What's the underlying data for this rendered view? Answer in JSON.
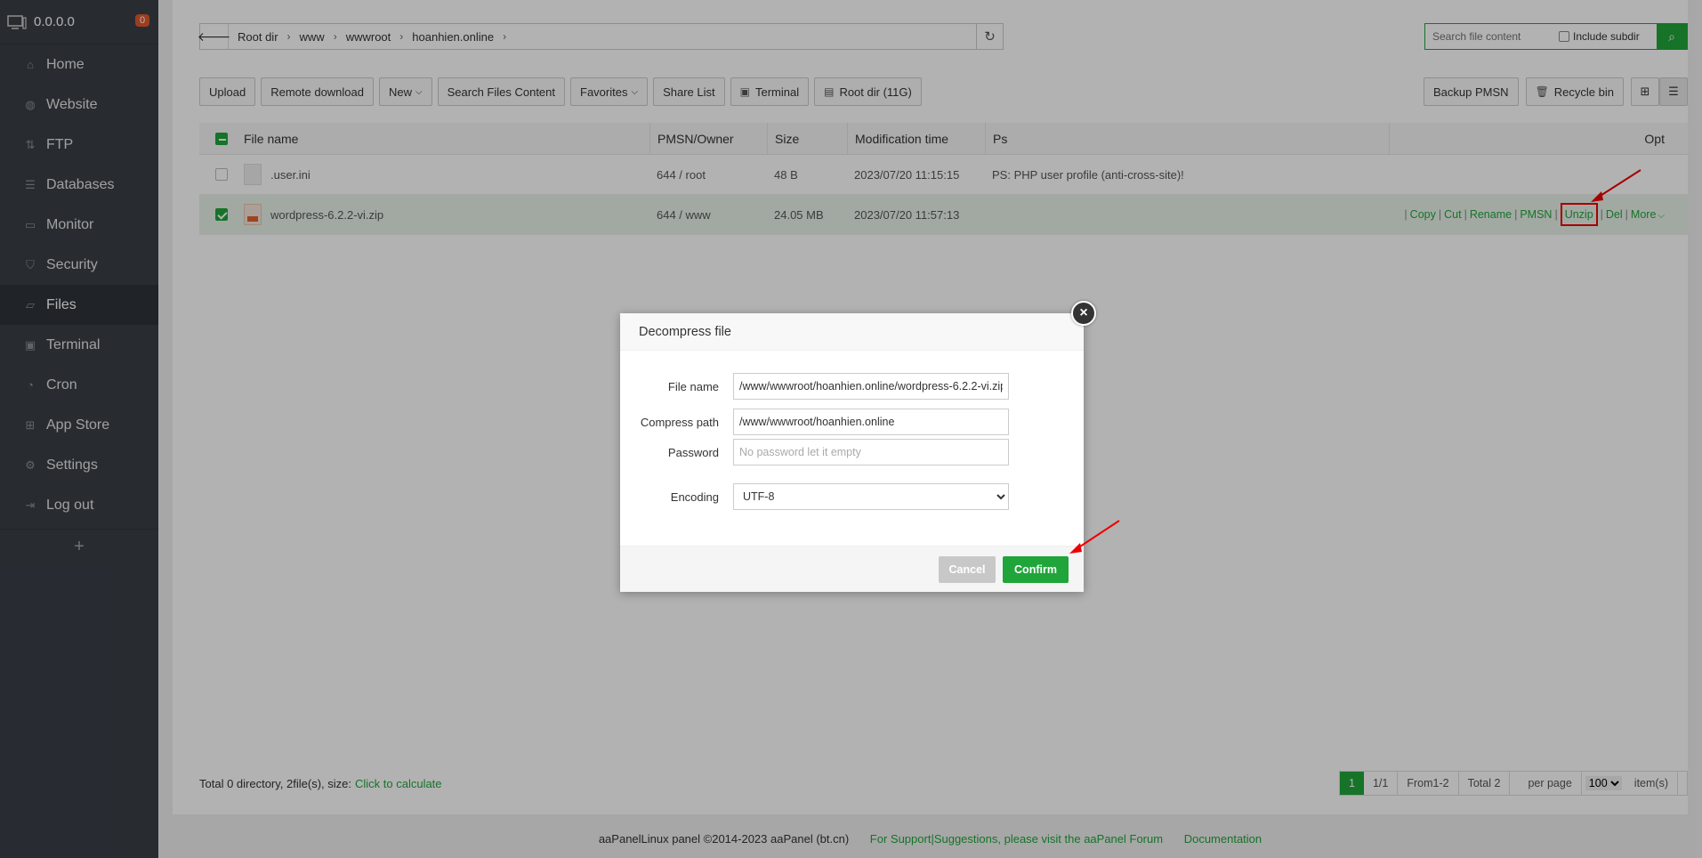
{
  "sidebar": {
    "ip": "0.0.0.0",
    "badge": "0",
    "items": [
      {
        "label": "Home",
        "icon": "home-icon"
      },
      {
        "label": "Website",
        "icon": "globe-icon"
      },
      {
        "label": "FTP",
        "icon": "ftp-icon"
      },
      {
        "label": "Databases",
        "icon": "database-icon"
      },
      {
        "label": "Monitor",
        "icon": "monitor-icon"
      },
      {
        "label": "Security",
        "icon": "shield-icon"
      },
      {
        "label": "Files",
        "icon": "folder-icon"
      },
      {
        "label": "Terminal",
        "icon": "terminal-icon"
      },
      {
        "label": "Cron",
        "icon": "clock-icon"
      },
      {
        "label": "App Store",
        "icon": "grid-icon"
      },
      {
        "label": "Settings",
        "icon": "gear-icon"
      },
      {
        "label": "Log out",
        "icon": "logout-icon"
      }
    ],
    "active": "Files",
    "add": "+"
  },
  "breadcrumb": [
    "Root dir",
    "www",
    "wwwroot",
    "hoanhien.online"
  ],
  "search": {
    "placeholder": "Search file content",
    "include_subdir": "Include subdir"
  },
  "toolbar": {
    "upload": "Upload",
    "remote_download": "Remote download",
    "new": "New",
    "search_files": "Search Files Content",
    "favorites": "Favorites",
    "share_list": "Share List",
    "terminal": "Terminal",
    "root_dir": "Root dir (11G)",
    "backup": "Backup PMSN",
    "recycle": "Recycle bin"
  },
  "table": {
    "headers": {
      "name": "File name",
      "perm": "PMSN/Owner",
      "size": "Size",
      "time": "Modification time",
      "ps": "Ps",
      "opt": "Opt"
    },
    "rows": [
      {
        "name": ".user.ini",
        "perm": "644 / root",
        "size": "48 B",
        "time": "2023/07/20 11:15:15",
        "ps": "PS: PHP user profile (anti-cross-site)!"
      },
      {
        "name": "wordpress-6.2.2-vi.zip",
        "perm": "644 / www",
        "size": "24.05 MB",
        "time": "2023/07/20 11:57:13",
        "ps": ""
      }
    ],
    "row_ops": [
      "Copy",
      "Cut",
      "Rename",
      "PMSN",
      "Unzip",
      "Del",
      "More"
    ]
  },
  "footer": {
    "summary": "Total 0 directory, 2file(s), size:",
    "calc": "Click to calculate",
    "page": "1",
    "pages": "1/1",
    "from": "From1-2",
    "total": "Total 2",
    "per_page": "per page",
    "per_page_value": "100",
    "items": "item(s)"
  },
  "copyright": {
    "text": "aaPanelLinux panel ©2014-2023 aaPanel (bt.cn)",
    "support": "For Support|Suggestions, please visit the aaPanel Forum",
    "docs": "Documentation"
  },
  "modal": {
    "title": "Decompress file",
    "file_name_label": "File name",
    "file_name_value": "/www/wwwroot/hoanhien.online/wordpress-6.2.2-vi.zip",
    "compress_path_label": "Compress path",
    "compress_path_value": "/www/wwwroot/hoanhien.online",
    "password_label": "Password",
    "password_placeholder": "No password let it empty",
    "encoding_label": "Encoding",
    "encoding_value": "UTF-8",
    "cancel": "Cancel",
    "confirm": "Confirm"
  },
  "colors": {
    "accent": "#20a53a",
    "sidebar": "#3a3f47",
    "highlight": "#e00000"
  }
}
